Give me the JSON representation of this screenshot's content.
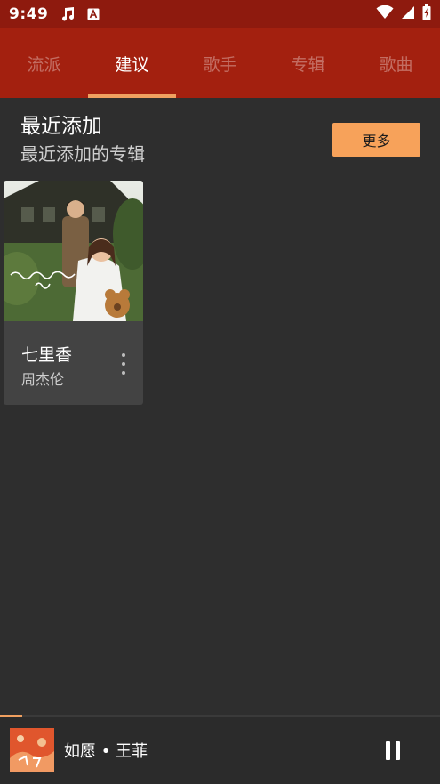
{
  "status_bar": {
    "time": "9:49",
    "left_icons": [
      "music-note-icon",
      "text-a-icon"
    ],
    "right_icons": [
      "wifi-icon",
      "signal-icon",
      "battery-charging-icon"
    ]
  },
  "tabs": [
    {
      "label": "流派",
      "active": false
    },
    {
      "label": "建议",
      "active": true
    },
    {
      "label": "歌手",
      "active": false
    },
    {
      "label": "专辑",
      "active": false
    },
    {
      "label": "歌曲",
      "active": false
    }
  ],
  "section": {
    "title": "最近添加",
    "subtitle": "最近添加的专辑",
    "more_label": "更多"
  },
  "albums": [
    {
      "title": "七里香",
      "artist": "周杰伦",
      "menu_icon": "more-vertical-icon"
    }
  ],
  "player": {
    "now_playing": "如愿 • 王菲",
    "progress": 0.05,
    "control_icon": "pause-icon"
  },
  "colors": {
    "status_bar": "#8e1a0e",
    "tab_bar": "#a3200f",
    "accent": "#f7a25a",
    "background": "#2e2e2e",
    "card": "#434343"
  }
}
